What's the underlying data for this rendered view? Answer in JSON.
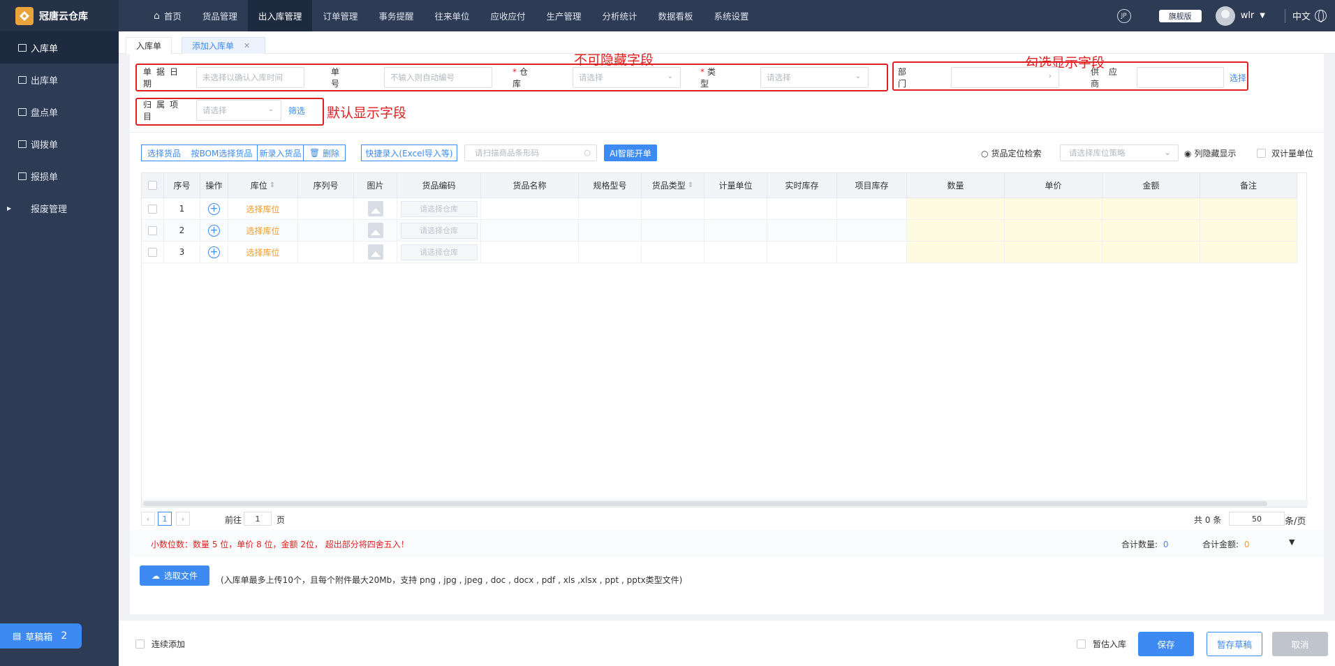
{
  "app": {
    "title": "冠唐云仓库",
    "logo_icon": "warehouse-logo-icon"
  },
  "nav": {
    "items": [
      {
        "label": "首页",
        "icon": "home-icon"
      },
      {
        "label": "货品管理"
      },
      {
        "label": "出入库管理",
        "active": true
      },
      {
        "label": "订单管理"
      },
      {
        "label": "事务提醒"
      },
      {
        "label": "往来单位"
      },
      {
        "label": "应收应付"
      },
      {
        "label": "生产管理"
      },
      {
        "label": "分析统计"
      },
      {
        "label": "数据看板"
      },
      {
        "label": "系统设置"
      }
    ]
  },
  "topright": {
    "edition": "旗舰版",
    "user": "wlr",
    "lang": "中文"
  },
  "sidebar": {
    "items": [
      {
        "label": "入库单",
        "active": true
      },
      {
        "label": "出库单"
      },
      {
        "label": "盘点单"
      },
      {
        "label": "调拨单"
      },
      {
        "label": "报损单"
      },
      {
        "label": "报废管理"
      }
    ]
  },
  "draft": {
    "label": "草稿箱",
    "count": "2"
  },
  "tabs": [
    {
      "label": "入库单"
    },
    {
      "label": "添加入库单"
    }
  ],
  "form": {
    "date_label": "单据日期",
    "date_placeholder": "未选择以确认入库时间",
    "no_label": "单号",
    "no_placeholder": "不输入则自动编号",
    "warehouse_label": "仓库",
    "warehouse_placeholder": "请选择",
    "type_label": "类型",
    "type_placeholder": "请选择",
    "dept_label": "部门",
    "supplier_label": "供应商",
    "supplier_select": "选择",
    "project_label": "归属项目",
    "project_placeholder": "请选择",
    "project_filter": "筛选"
  },
  "annotations": {
    "fixed": "不可隐藏字段",
    "optional": "勾选显示字段",
    "default": "默认显示字段"
  },
  "toolbar": {
    "select_goods": "选择货品",
    "bom_select": "按BOM选择货品",
    "new_goods": "新录入货品",
    "delete": "删除",
    "quick_entry": "快捷录入(Excel导入等)",
    "scan_placeholder": "请扫描商品条形码",
    "ai": "AI智能开单",
    "locate": "货品定位检索",
    "strategy_placeholder": "请选择库位策略",
    "hidden_cols": "列隐藏显示",
    "dual_unit": "双计量单位"
  },
  "table": {
    "headers": [
      "序号",
      "操作",
      "库位",
      "序列号",
      "图片",
      "货品编码",
      "货品名称",
      "规格型号",
      "货品类型",
      "计量单位",
      "实时库存",
      "项目库存",
      "数量",
      "单价",
      "金额",
      "备注"
    ],
    "rows": [
      {
        "no": "1",
        "loc": "选择库位",
        "wh": "请选择仓库"
      },
      {
        "no": "2",
        "loc": "选择库位",
        "wh": "请选择仓库"
      },
      {
        "no": "3",
        "loc": "选择库位",
        "wh": "请选择仓库"
      }
    ]
  },
  "pagination": {
    "page": "1",
    "goto_prefix": "前往",
    "goto_value": "1",
    "goto_suffix": "页",
    "total": "共 0 条",
    "page_size": "50",
    "per_page": "条/页"
  },
  "summary": {
    "notice": "小数位数：数量 5 位，单价 8 位，金额 2位， 超出部分将四舍五入！",
    "qty_label": "合计数量:",
    "qty": "0",
    "amount_label": "合计金额:",
    "amount": "0"
  },
  "upload": {
    "button": "选取文件",
    "hint": "(入库单最多上传10个，且每个附件最大20Mb，支持 png , jpg , jpeg , doc , docx , pdf , xls ,xlsx , ppt , pptx类型文件)"
  },
  "footer": {
    "continuous": "连续添加",
    "temp_in": "暂估入库",
    "save": "保存",
    "save_draft": "暂存草稿",
    "cancel": "取消"
  },
  "colors": {
    "accent": "#3d8bf2",
    "sidebar": "#2e3b55",
    "annotation": "#e02020",
    "location": "#f39b2c"
  }
}
